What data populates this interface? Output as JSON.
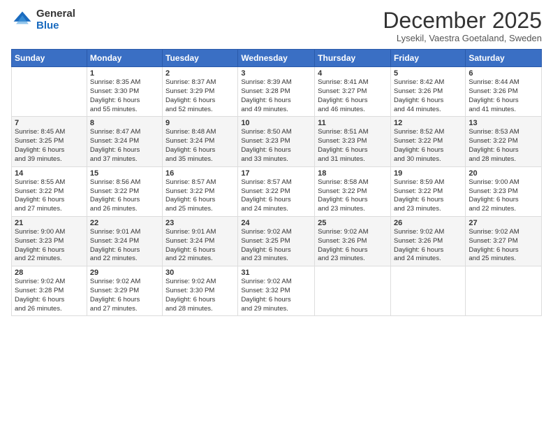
{
  "header": {
    "logo_general": "General",
    "logo_blue": "Blue",
    "month_title": "December 2025",
    "location": "Lysekil, Vaestra Goetaland, Sweden"
  },
  "days_of_week": [
    "Sunday",
    "Monday",
    "Tuesday",
    "Wednesday",
    "Thursday",
    "Friday",
    "Saturday"
  ],
  "weeks": [
    [
      {
        "num": "",
        "info": ""
      },
      {
        "num": "1",
        "info": "Sunrise: 8:35 AM\nSunset: 3:30 PM\nDaylight: 6 hours\nand 55 minutes."
      },
      {
        "num": "2",
        "info": "Sunrise: 8:37 AM\nSunset: 3:29 PM\nDaylight: 6 hours\nand 52 minutes."
      },
      {
        "num": "3",
        "info": "Sunrise: 8:39 AM\nSunset: 3:28 PM\nDaylight: 6 hours\nand 49 minutes."
      },
      {
        "num": "4",
        "info": "Sunrise: 8:41 AM\nSunset: 3:27 PM\nDaylight: 6 hours\nand 46 minutes."
      },
      {
        "num": "5",
        "info": "Sunrise: 8:42 AM\nSunset: 3:26 PM\nDaylight: 6 hours\nand 44 minutes."
      },
      {
        "num": "6",
        "info": "Sunrise: 8:44 AM\nSunset: 3:26 PM\nDaylight: 6 hours\nand 41 minutes."
      }
    ],
    [
      {
        "num": "7",
        "info": "Sunrise: 8:45 AM\nSunset: 3:25 PM\nDaylight: 6 hours\nand 39 minutes."
      },
      {
        "num": "8",
        "info": "Sunrise: 8:47 AM\nSunset: 3:24 PM\nDaylight: 6 hours\nand 37 minutes."
      },
      {
        "num": "9",
        "info": "Sunrise: 8:48 AM\nSunset: 3:24 PM\nDaylight: 6 hours\nand 35 minutes."
      },
      {
        "num": "10",
        "info": "Sunrise: 8:50 AM\nSunset: 3:23 PM\nDaylight: 6 hours\nand 33 minutes."
      },
      {
        "num": "11",
        "info": "Sunrise: 8:51 AM\nSunset: 3:23 PM\nDaylight: 6 hours\nand 31 minutes."
      },
      {
        "num": "12",
        "info": "Sunrise: 8:52 AM\nSunset: 3:22 PM\nDaylight: 6 hours\nand 30 minutes."
      },
      {
        "num": "13",
        "info": "Sunrise: 8:53 AM\nSunset: 3:22 PM\nDaylight: 6 hours\nand 28 minutes."
      }
    ],
    [
      {
        "num": "14",
        "info": "Sunrise: 8:55 AM\nSunset: 3:22 PM\nDaylight: 6 hours\nand 27 minutes."
      },
      {
        "num": "15",
        "info": "Sunrise: 8:56 AM\nSunset: 3:22 PM\nDaylight: 6 hours\nand 26 minutes."
      },
      {
        "num": "16",
        "info": "Sunrise: 8:57 AM\nSunset: 3:22 PM\nDaylight: 6 hours\nand 25 minutes."
      },
      {
        "num": "17",
        "info": "Sunrise: 8:57 AM\nSunset: 3:22 PM\nDaylight: 6 hours\nand 24 minutes."
      },
      {
        "num": "18",
        "info": "Sunrise: 8:58 AM\nSunset: 3:22 PM\nDaylight: 6 hours\nand 23 minutes."
      },
      {
        "num": "19",
        "info": "Sunrise: 8:59 AM\nSunset: 3:22 PM\nDaylight: 6 hours\nand 23 minutes."
      },
      {
        "num": "20",
        "info": "Sunrise: 9:00 AM\nSunset: 3:23 PM\nDaylight: 6 hours\nand 22 minutes."
      }
    ],
    [
      {
        "num": "21",
        "info": "Sunrise: 9:00 AM\nSunset: 3:23 PM\nDaylight: 6 hours\nand 22 minutes."
      },
      {
        "num": "22",
        "info": "Sunrise: 9:01 AM\nSunset: 3:24 PM\nDaylight: 6 hours\nand 22 minutes."
      },
      {
        "num": "23",
        "info": "Sunrise: 9:01 AM\nSunset: 3:24 PM\nDaylight: 6 hours\nand 22 minutes."
      },
      {
        "num": "24",
        "info": "Sunrise: 9:02 AM\nSunset: 3:25 PM\nDaylight: 6 hours\nand 23 minutes."
      },
      {
        "num": "25",
        "info": "Sunrise: 9:02 AM\nSunset: 3:26 PM\nDaylight: 6 hours\nand 23 minutes."
      },
      {
        "num": "26",
        "info": "Sunrise: 9:02 AM\nSunset: 3:26 PM\nDaylight: 6 hours\nand 24 minutes."
      },
      {
        "num": "27",
        "info": "Sunrise: 9:02 AM\nSunset: 3:27 PM\nDaylight: 6 hours\nand 25 minutes."
      }
    ],
    [
      {
        "num": "28",
        "info": "Sunrise: 9:02 AM\nSunset: 3:28 PM\nDaylight: 6 hours\nand 26 minutes."
      },
      {
        "num": "29",
        "info": "Sunrise: 9:02 AM\nSunset: 3:29 PM\nDaylight: 6 hours\nand 27 minutes."
      },
      {
        "num": "30",
        "info": "Sunrise: 9:02 AM\nSunset: 3:30 PM\nDaylight: 6 hours\nand 28 minutes."
      },
      {
        "num": "31",
        "info": "Sunrise: 9:02 AM\nSunset: 3:32 PM\nDaylight: 6 hours\nand 29 minutes."
      },
      {
        "num": "",
        "info": ""
      },
      {
        "num": "",
        "info": ""
      },
      {
        "num": "",
        "info": ""
      }
    ]
  ]
}
